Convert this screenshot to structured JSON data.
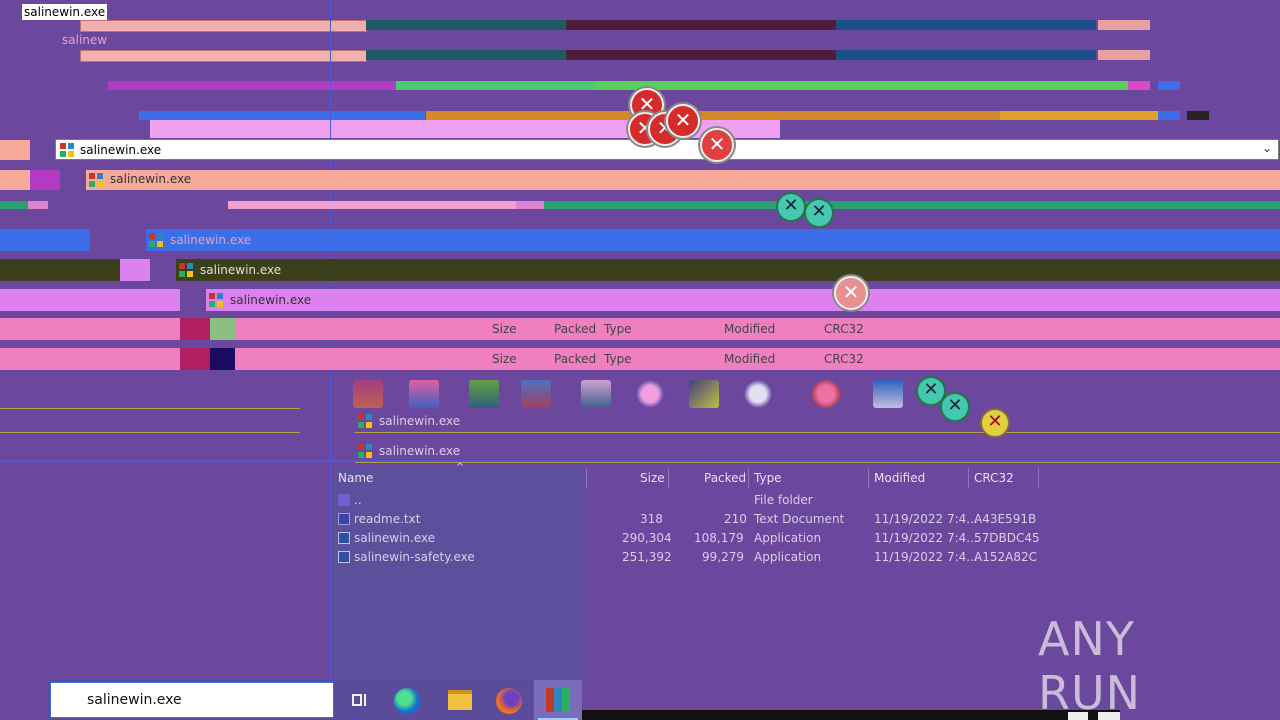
{
  "title_chip": "salinewin.exe",
  "ghost_labels": {
    "a": "salinew",
    "b": "salinew",
    "c": "salinewin.exe",
    "d": "salinewin.exe",
    "e": "salinewin.exe",
    "f": "salinewin.exe"
  },
  "address_bar": {
    "value": "salinewin.exe"
  },
  "ghost_addresses": [
    "salinewin.exe",
    "salinewin.exe",
    "salinewin.exe",
    "salinewin.exe"
  ],
  "ghost_headers": {
    "size": "Size",
    "packed": "Packed",
    "type": "Type",
    "modified": "Modified",
    "crc": "CRC32"
  },
  "lower_ghost_addresses": [
    "salinewin.exe",
    "salinewin.exe"
  ],
  "file_list": {
    "columns": [
      "Name",
      "Size",
      "Packed",
      "Type",
      "Modified",
      "CRC32"
    ],
    "rows": [
      {
        "name": "..",
        "size": "",
        "packed": "",
        "type": "File folder",
        "modified": "",
        "crc": ""
      },
      {
        "name": "readme.txt",
        "size": "318",
        "packed": "210",
        "type": "Text Document",
        "modified": "11/19/2022 7:4...",
        "crc": "A43E591B"
      },
      {
        "name": "salinewin.exe",
        "size": "290,304",
        "packed": "108,179",
        "type": "Application",
        "modified": "11/19/2022 7:4...",
        "crc": "57DBDC45"
      },
      {
        "name": "salinewin-safety.exe",
        "size": "251,392",
        "packed": "99,279",
        "type": "Application",
        "modified": "11/19/2022 7:4...",
        "crc": "A152A82C"
      }
    ]
  },
  "taskbar": {
    "search_value": "salinewin.exe",
    "icons": [
      "task-view-icon",
      "edge-icon",
      "file-explorer-icon",
      "firefox-icon",
      "winrar-icon"
    ]
  },
  "watermark": {
    "text": "ANY RUN"
  },
  "colors": {
    "background": "#6b479e",
    "pink": "#ef7fbf",
    "salmon": "#f7a99a",
    "blue": "#3c6ee8",
    "olive": "#3b3f1c",
    "violet": "#db82f0",
    "error_red": "#d62b2b"
  }
}
